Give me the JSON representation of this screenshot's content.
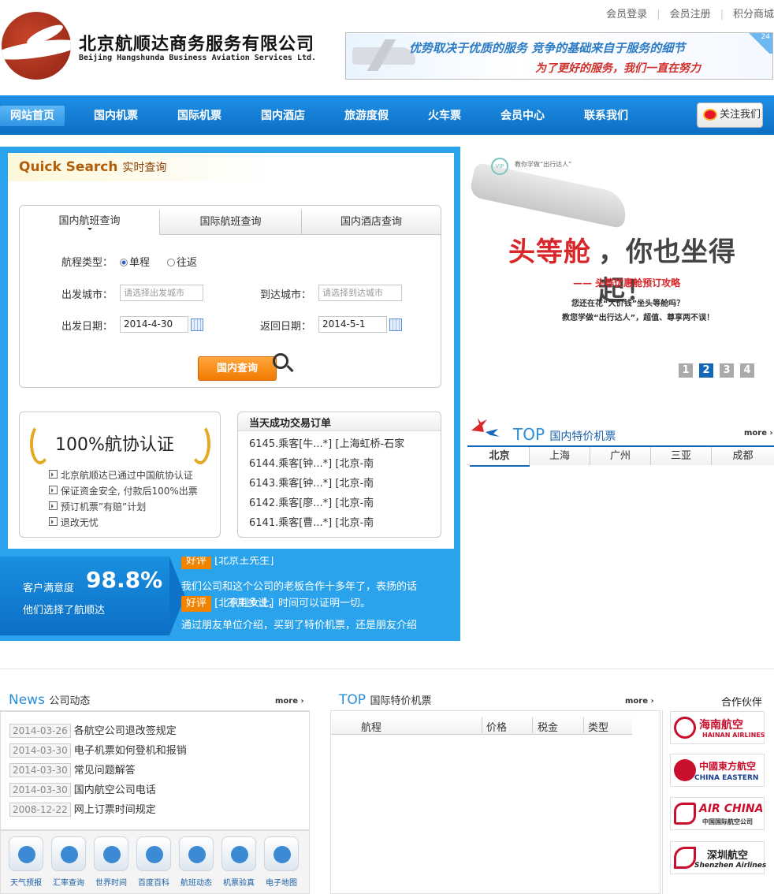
{
  "header": {
    "top_links": [
      "会员登录",
      "会员注册",
      "积分商城"
    ],
    "company_cn": "北京航顺达商务服务有限公司",
    "company_en": "Beijing Hangshunda Business Aviation Services Ltd.",
    "banner_line1": "优势取决于优质的服务  竞争的基础来自于服务的细节",
    "banner_line2": "为了更好的服务，我们一直在努力",
    "banner_badge": "24"
  },
  "nav": {
    "items": [
      "网站首页",
      "国内机票",
      "国际机票",
      "国内酒店",
      "旅游度假",
      "火车票",
      "会员中心",
      "联系我们"
    ],
    "follow": "关注我们"
  },
  "quick_search": {
    "title_en": "Quick Search",
    "title_cn": "实时查询",
    "tabs": [
      "国内航班查询",
      "国际航班查询",
      "国内酒店查询"
    ],
    "trip_type_label": "航程类型：",
    "trip_oneway": "单程",
    "trip_round": "往返",
    "from_label": "出发城市：",
    "from_placeholder": "请选择出发城市",
    "to_label": "到达城市：",
    "to_placeholder": "请选择到达城市",
    "depart_label": "出发日期：",
    "depart_value": "2014-4-30",
    "return_label": "返回日期：",
    "return_value": "2014-5-1",
    "search_button": "国内查询"
  },
  "certification": {
    "title": "100%航协认证",
    "lines": [
      "北京航顺达已通过中国航协认证",
      "保证资金安全, 付款后100%出票",
      "预订机票”有赔”计划",
      "退改无忧"
    ]
  },
  "orders": {
    "title": "当天成功交易订单",
    "rows": [
      "6145.乘客[牛...*]  [上海虹桥-石家",
      "6144.乘客[钟...*]  [北京-南",
      "6143.乘客[钟...*]  [北京-南",
      "6142.乘客[廖...*]  [北京-南",
      "6141.乘客[曹...*]  [北京-南"
    ]
  },
  "satisfaction": {
    "label": "客户满意度",
    "percent": "98.8%",
    "sub": "他们选择了航顺达",
    "reviews": [
      {
        "badge": "好评",
        "author": "[北京王先生]",
        "text": "我们公司和这个公司的老板合作十多年了，表扬的话"
      },
      {
        "badge": "好评",
        "author": "[北京刘女士]",
        "text": "不用多说，时间可以证明一切。"
      },
      {
        "text": "通过朋友单位介绍，买到了特价机票，还是朋友介绍"
      }
    ]
  },
  "promo": {
    "vip": "VIP",
    "tag": "教你学做“出行达人”",
    "headline_red": "头等舱",
    "headline_dark": "，你也坐得起！",
    "sub": "—— 头等优惠舱预订攻略",
    "line1": "您还在花“大价钱”坐头等舱吗？",
    "line2": "教您学做“出行达人”，超值、尊享两不误！",
    "pages": [
      "1",
      "2",
      "3",
      "4"
    ],
    "active_page": "2"
  },
  "top_domestic": {
    "label_en": "TOP",
    "label_cn": "国内特价机票",
    "more": "more",
    "cities": [
      "北京",
      "上海",
      "广州",
      "三亚",
      "成都"
    ]
  },
  "news": {
    "label_en": "News",
    "label_cn": "公司动态",
    "more": "more",
    "items": [
      {
        "date": "2014-03-26",
        "title": "各航空公司退改签规定"
      },
      {
        "date": "2014-03-30",
        "title": "电子机票如何登机和报销"
      },
      {
        "date": "2014-03-30",
        "title": "常见问题解答"
      },
      {
        "date": "2014-03-30",
        "title": "国内航空公司电话"
      },
      {
        "date": "2008-12-22",
        "title": "网上订票时间规定"
      }
    ]
  },
  "tools": [
    "天气预报",
    "汇率查询",
    "世界时间",
    "百度百科",
    "航班动态",
    "机票验真",
    "电子地图"
  ],
  "intl": {
    "label_en": "TOP",
    "label_cn": "国际特价机票",
    "more": "more",
    "columns": [
      "航程",
      "价格",
      "税金",
      "类型"
    ]
  },
  "partners": {
    "title": "合作伙伴",
    "items": [
      {
        "cn": "海南航空",
        "en": "HAINAN AIRLINES",
        "color": "#c8102e"
      },
      {
        "cn": "中國東方航空",
        "en": "CHINA EASTERN",
        "color": "#c8102e"
      },
      {
        "cn": "AIR CHINA",
        "en": "中国国际航空公司",
        "color": "#c8102e"
      },
      {
        "cn": "深圳航空",
        "en": "Shenzhen Airlines",
        "color": "#c8102e"
      }
    ]
  }
}
